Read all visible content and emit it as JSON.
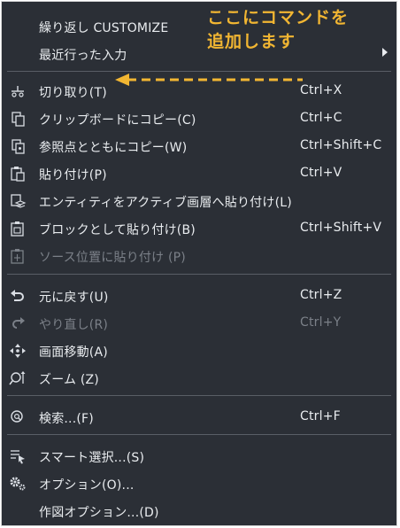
{
  "menu": {
    "items": [
      {
        "label": "繰り返し CUSTOMIZE",
        "shortcut": "",
        "icon": "none"
      },
      {
        "label": "最近行った入力",
        "shortcut": "",
        "icon": "none",
        "submenu": true
      },
      {
        "label": "切り取り(T)",
        "shortcut": "Ctrl+X",
        "icon": "scissors-icon"
      },
      {
        "label": "クリップボードにコピー(C)",
        "shortcut": "Ctrl+C",
        "icon": "copy-icon"
      },
      {
        "label": "参照点とともにコピー(W)",
        "shortcut": "Ctrl+Shift+C",
        "icon": "copy-basepoint-icon"
      },
      {
        "label": "貼り付け(P)",
        "shortcut": "Ctrl+V",
        "icon": "paste-icon"
      },
      {
        "label": "エンティティをアクティブ画層へ貼り付け(L)",
        "shortcut": "",
        "icon": "paste-to-layer-icon"
      },
      {
        "label": "ブロックとして貼り付け(B)",
        "shortcut": "Ctrl+Shift+V",
        "icon": "paste-as-block-icon"
      },
      {
        "label": "ソース位置に貼り付け (P)",
        "shortcut": "",
        "icon": "paste-original-icon",
        "disabled": true
      },
      {
        "label": "元に戻す(U)",
        "shortcut": "Ctrl+Z",
        "icon": "undo-icon"
      },
      {
        "label": "やり直し(R)",
        "shortcut": "Ctrl+Y",
        "icon": "redo-icon",
        "disabled": true
      },
      {
        "label": "画面移動(A)",
        "shortcut": "",
        "icon": "pan-icon"
      },
      {
        "label": "ズーム (Z)",
        "shortcut": "",
        "icon": "zoom-icon"
      },
      {
        "label": "検索...(F)",
        "shortcut": "Ctrl+F",
        "icon": "find-icon"
      },
      {
        "label": "スマート選択...(S)",
        "shortcut": "",
        "icon": "smart-select-icon"
      },
      {
        "label": "オプション(O)...",
        "shortcut": "",
        "icon": "options-gear-icon"
      },
      {
        "label": "作図オプション...(D)",
        "shortcut": "",
        "icon": "none"
      }
    ]
  },
  "annotation": {
    "line1": "ここにコマンドを",
    "line2": "追加します",
    "color": "#f2b632"
  },
  "colors": {
    "menu_bg": "#2b2f36",
    "text": "#e9ecef",
    "disabled_text": "#7b8088",
    "separator": "#595e66"
  }
}
